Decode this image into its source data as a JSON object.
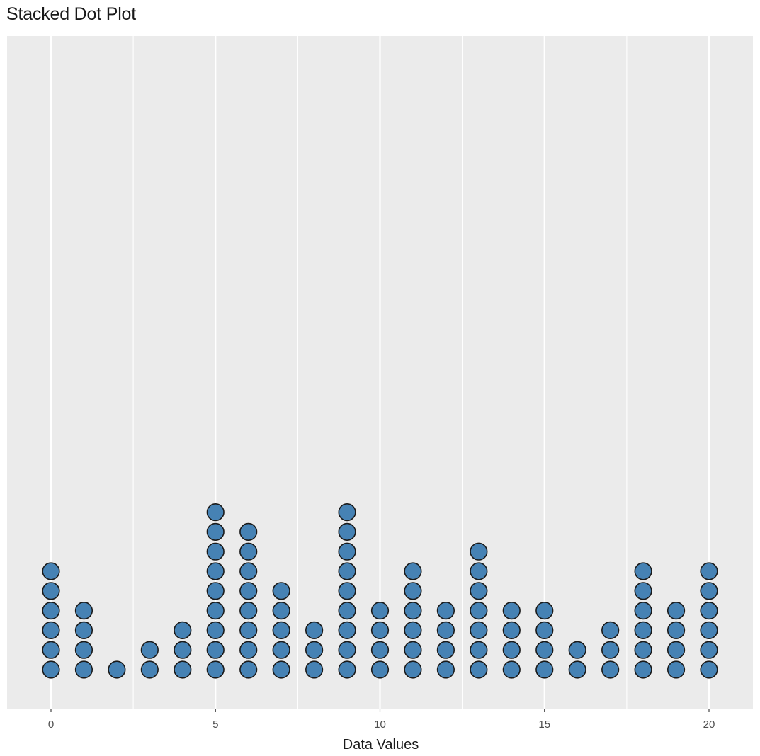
{
  "chart_data": {
    "type": "dotplot",
    "title": "Stacked Dot Plot",
    "xlabel": "Data Values",
    "ylabel": "",
    "x_ticks": [
      0,
      5,
      10,
      15,
      20
    ],
    "x_tick_labels": [
      "0",
      "5",
      "10",
      "15",
      "20"
    ],
    "xlim": [
      -1.3,
      21.35
    ],
    "grid": true,
    "y_axis_shown": false,
    "x": [
      0,
      1,
      2,
      3,
      4,
      5,
      6,
      7,
      8,
      9,
      10,
      11,
      12,
      13,
      14,
      15,
      16,
      17,
      18,
      19,
      20
    ],
    "counts": [
      6,
      4,
      1,
      2,
      3,
      9,
      8,
      5,
      3,
      9,
      4,
      6,
      4,
      7,
      4,
      4,
      2,
      3,
      6,
      4,
      6
    ],
    "dot_fill": "#4682b4",
    "dot_stroke": "#1a1a1a",
    "panel_background": "#ebebeb",
    "grid_color": "#ffffff"
  }
}
